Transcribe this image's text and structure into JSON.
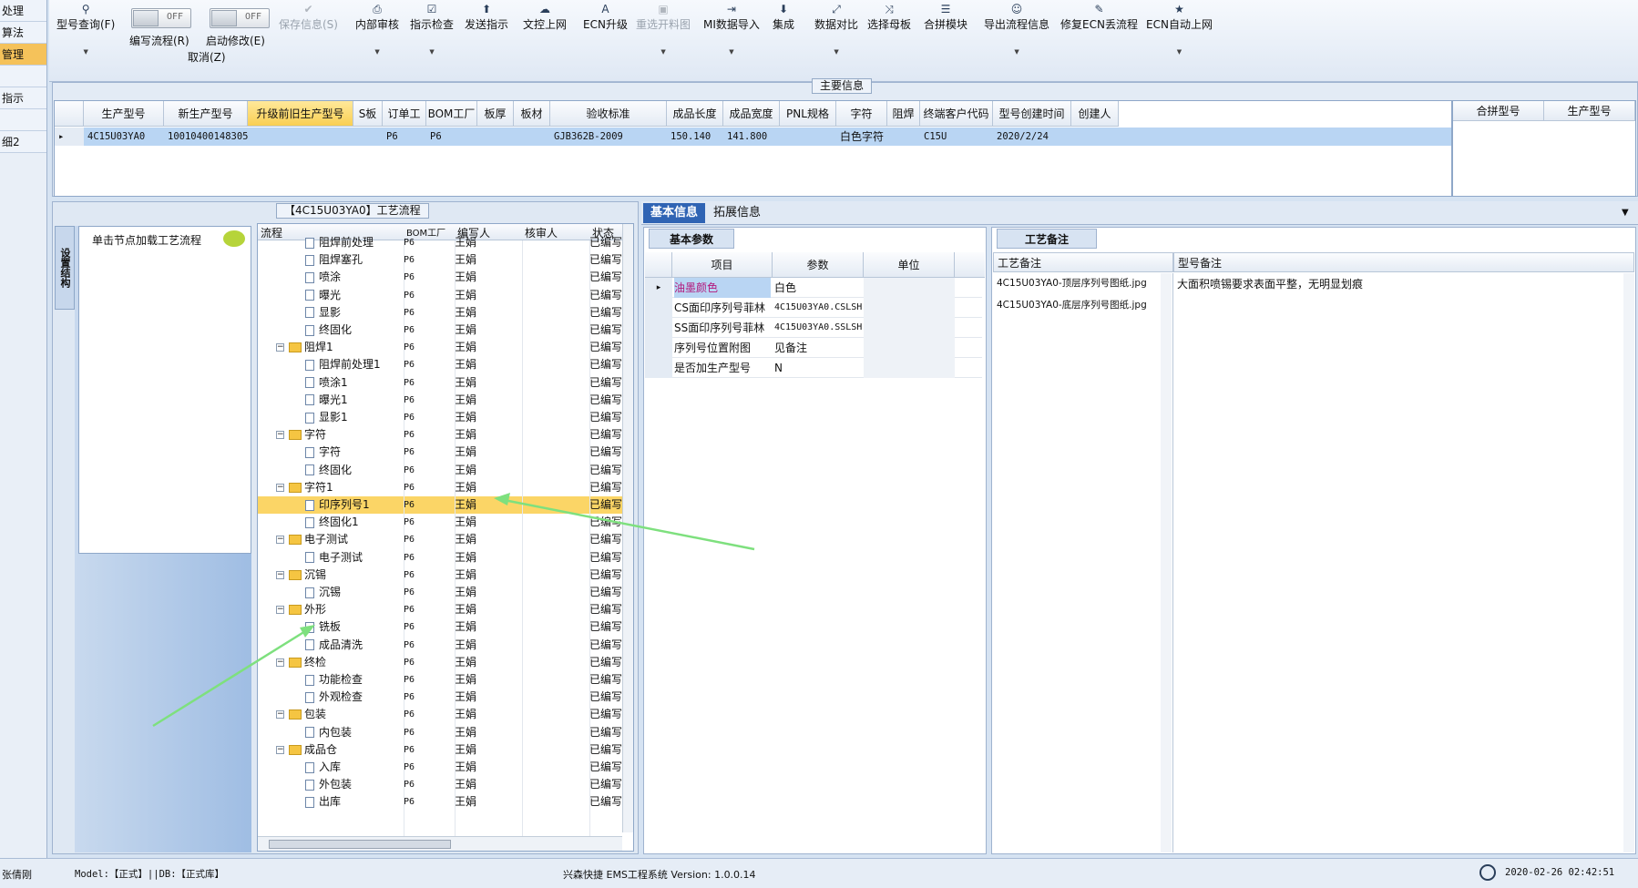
{
  "nav": {
    "items": [
      "处理",
      "算法",
      "管理",
      "",
      "指示",
      "",
      "细2"
    ]
  },
  "toolbar": {
    "buttons": [
      {
        "icon": "⚲",
        "label": "型号查询(F)"
      },
      {
        "icon": "",
        "label": "编写流程(R)"
      },
      {
        "icon": "",
        "label": "启动修改(E)"
      },
      {
        "icon": "✔",
        "label": "保存信息(S)"
      },
      {
        "icon": "⎙",
        "label": "内部审核"
      },
      {
        "icon": "☑",
        "label": "指示检查"
      },
      {
        "icon": "⬆",
        "label": "发送指示"
      },
      {
        "icon": "☁",
        "label": "文控上网"
      },
      {
        "icon": "A",
        "label": "ECN升级"
      },
      {
        "icon": "▣",
        "label": "重选开料图"
      },
      {
        "icon": "⇥",
        "label": "MI数据导入"
      },
      {
        "icon": "⬇",
        "label": "集成"
      },
      {
        "icon": "⤢",
        "label": "数据对比"
      },
      {
        "icon": "⤨",
        "label": "选择母板"
      },
      {
        "icon": "☰",
        "label": "合拼模块"
      },
      {
        "icon": "☺",
        "label": "导出流程信息"
      },
      {
        "icon": "✎",
        "label": "修复ECN丢流程"
      },
      {
        "icon": "★",
        "label": "ECN自动上网"
      }
    ],
    "toggle_label": "OFF",
    "cancel_label": "取消(Z)"
  },
  "main_info": {
    "title": "主要信息",
    "columns": [
      "生产型号",
      "新生产型号",
      "升级前旧生产型号",
      "S板",
      "订单工厂",
      "BOM工厂",
      "板厚",
      "板材",
      "验收标准",
      "成品长度",
      "成品宽度",
      "PNL规格",
      "字符",
      "阻焊",
      "终端客户代码",
      "型号创建时间",
      "创建人"
    ],
    "row": [
      "4C15U03YA0",
      "10010400148305",
      "",
      "",
      "P6",
      "P6",
      "",
      "",
      "GJB362B-2009",
      "150.140",
      "141.800",
      "",
      "白色字符",
      "",
      "C15U",
      "2020/2/24",
      ""
    ],
    "side_columns": [
      "合拼型号",
      "生产型号"
    ]
  },
  "flow": {
    "title": "【4C15U03YA0】工艺流程",
    "side_tab": "设置结构",
    "hint": "单击节点加载工艺流程",
    "columns": [
      "流程",
      "BOM工厂",
      "编写人",
      "核审人",
      "状态"
    ],
    "rows": [
      {
        "name": "阻焊前处理",
        "level": 2,
        "folder": false,
        "bom": "P6",
        "writer": "王娟",
        "status": "已编写"
      },
      {
        "name": "阻焊塞孔",
        "level": 2,
        "folder": false,
        "bom": "P6",
        "writer": "王娟",
        "status": "已编写"
      },
      {
        "name": "喷涂",
        "level": 2,
        "folder": false,
        "bom": "P6",
        "writer": "王娟",
        "status": "已编写"
      },
      {
        "name": "曝光",
        "level": 2,
        "folder": false,
        "bom": "P6",
        "writer": "王娟",
        "status": "已编写"
      },
      {
        "name": "显影",
        "level": 2,
        "folder": false,
        "bom": "P6",
        "writer": "王娟",
        "status": "已编写"
      },
      {
        "name": "终固化",
        "level": 2,
        "folder": false,
        "bom": "P6",
        "writer": "王娟",
        "status": "已编写"
      },
      {
        "name": "阻焊1",
        "level": 1,
        "folder": true,
        "bom": "P6",
        "writer": "王娟",
        "status": "已编写"
      },
      {
        "name": "阻焊前处理1",
        "level": 2,
        "folder": false,
        "bom": "P6",
        "writer": "王娟",
        "status": "已编写"
      },
      {
        "name": "喷涂1",
        "level": 2,
        "folder": false,
        "bom": "P6",
        "writer": "王娟",
        "status": "已编写"
      },
      {
        "name": "曝光1",
        "level": 2,
        "folder": false,
        "bom": "P6",
        "writer": "王娟",
        "status": "已编写"
      },
      {
        "name": "显影1",
        "level": 2,
        "folder": false,
        "bom": "P6",
        "writer": "王娟",
        "status": "已编写"
      },
      {
        "name": "字符",
        "level": 1,
        "folder": true,
        "bom": "P6",
        "writer": "王娟",
        "status": "已编写"
      },
      {
        "name": "字符",
        "level": 2,
        "folder": false,
        "bom": "P6",
        "writer": "王娟",
        "status": "已编写"
      },
      {
        "name": "终固化",
        "level": 2,
        "folder": false,
        "bom": "P6",
        "writer": "王娟",
        "status": "已编写"
      },
      {
        "name": "字符1",
        "level": 1,
        "folder": true,
        "bom": "P6",
        "writer": "王娟",
        "status": "已编写"
      },
      {
        "name": "印序列号1",
        "level": 2,
        "folder": false,
        "bom": "P6",
        "writer": "王娟",
        "status": "已编写",
        "selected": true
      },
      {
        "name": "终固化1",
        "level": 2,
        "folder": false,
        "bom": "P6",
        "writer": "王娟",
        "status": "已编写"
      },
      {
        "name": "电子测试",
        "level": 1,
        "folder": true,
        "bom": "P6",
        "writer": "王娟",
        "status": "已编写"
      },
      {
        "name": "电子测试",
        "level": 2,
        "folder": false,
        "bom": "P6",
        "writer": "王娟",
        "status": "已编写"
      },
      {
        "name": "沉锡",
        "level": 1,
        "folder": true,
        "bom": "P6",
        "writer": "王娟",
        "status": "已编写"
      },
      {
        "name": "沉锡",
        "level": 2,
        "folder": false,
        "bom": "P6",
        "writer": "王娟",
        "status": "已编写"
      },
      {
        "name": "外形",
        "level": 1,
        "folder": true,
        "bom": "P6",
        "writer": "王娟",
        "status": "已编写"
      },
      {
        "name": "铣板",
        "level": 2,
        "folder": false,
        "bom": "P6",
        "writer": "王娟",
        "status": "已编写"
      },
      {
        "name": "成品清洗",
        "level": 2,
        "folder": false,
        "bom": "P6",
        "writer": "王娟",
        "status": "已编写"
      },
      {
        "name": "终检",
        "level": 1,
        "folder": true,
        "bom": "P6",
        "writer": "王娟",
        "status": "已编写"
      },
      {
        "name": "功能检查",
        "level": 2,
        "folder": false,
        "bom": "P6",
        "writer": "王娟",
        "status": "已编写"
      },
      {
        "name": "外观检查",
        "level": 2,
        "folder": false,
        "bom": "P6",
        "writer": "王娟",
        "status": "已编写"
      },
      {
        "name": "包装",
        "level": 1,
        "folder": true,
        "bom": "P6",
        "writer": "王娟",
        "status": "已编写"
      },
      {
        "name": "内包装",
        "level": 2,
        "folder": false,
        "bom": "P6",
        "writer": "王娟",
        "status": "已编写"
      },
      {
        "name": "成品仓",
        "level": 1,
        "folder": true,
        "bom": "P6",
        "writer": "王娟",
        "status": "已编写"
      },
      {
        "name": "入库",
        "level": 2,
        "folder": false,
        "bom": "P6",
        "writer": "王娟",
        "status": "已编写"
      },
      {
        "name": "外包装",
        "level": 2,
        "folder": false,
        "bom": "P6",
        "writer": "王娟",
        "status": "已编写"
      },
      {
        "name": "出库",
        "level": 2,
        "folder": false,
        "bom": "P6",
        "writer": "王娟",
        "status": "已编写"
      }
    ]
  },
  "right_tabs": [
    "基本信息",
    "拓展信息"
  ],
  "params": {
    "title": "基本参数",
    "columns": [
      "项目",
      "参数",
      "单位"
    ],
    "rows": [
      {
        "item": "油墨颜色",
        "value": "白色",
        "unit": ""
      },
      {
        "item": "CS面印序列号菲林",
        "value": "4C15U03YA0.CSLSH",
        "unit": ""
      },
      {
        "item": "SS面印序列号菲林",
        "value": "4C15U03YA0.SSLSH",
        "unit": ""
      },
      {
        "item": "序列号位置附图",
        "value": "见备注",
        "unit": ""
      },
      {
        "item": "是否加生产型号",
        "value": "N",
        "unit": ""
      }
    ]
  },
  "remarks": {
    "title": "工艺备注",
    "col1": "工艺备注",
    "col2": "型号备注",
    "files": [
      "4C15U03YA0-顶层序列号图纸.jpg",
      "4C15U03YA0-底层序列号图纸.jpg"
    ],
    "model_note": "大面积喷锡要求表面平整，无明显划痕"
  },
  "status": {
    "user": "张倩刚",
    "model": "Model:【正式】||DB:【正式库】",
    "system": "兴森快捷 EMS工程系统 Version: 1.0.0.14",
    "time": "2020-02-26 02:42:51"
  }
}
